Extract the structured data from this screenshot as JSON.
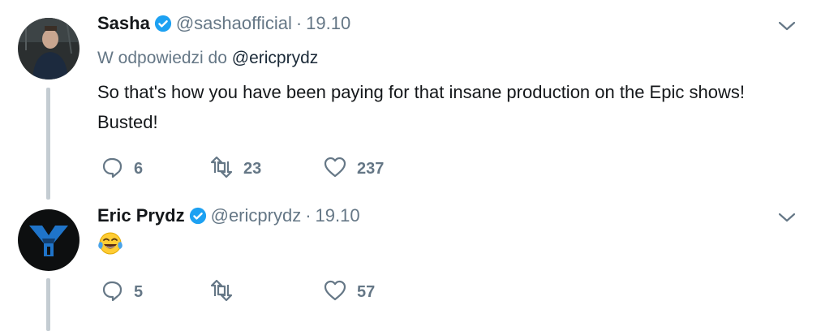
{
  "tweets": [
    {
      "name": "Sasha",
      "handle": "@sashaofficial",
      "separator": "·",
      "time": "19.10",
      "reply_prefix": "W odpowiedzi do",
      "reply_handle": "@ericprydz",
      "text": "So that's how you have been paying for that insane production on the Epic shows! Busted!",
      "replies": "6",
      "retweets": "23",
      "likes": "237"
    },
    {
      "name": "Eric Prydz",
      "handle": "@ericprydz",
      "separator": "·",
      "time": "19.10",
      "text": "😂",
      "replies": "5",
      "retweets": "",
      "likes": "57"
    }
  ],
  "icons": {
    "verified": "verified-badge-icon",
    "caret": "chevron-down-icon",
    "reply": "reply-icon",
    "retweet": "retweet-icon",
    "like": "heart-icon",
    "emoji": "face-with-tears-of-joy"
  },
  "colors": {
    "text": "#14171a",
    "secondary": "#657786",
    "verified": "#1da1f2",
    "thread_line": "#c4ccd2"
  }
}
